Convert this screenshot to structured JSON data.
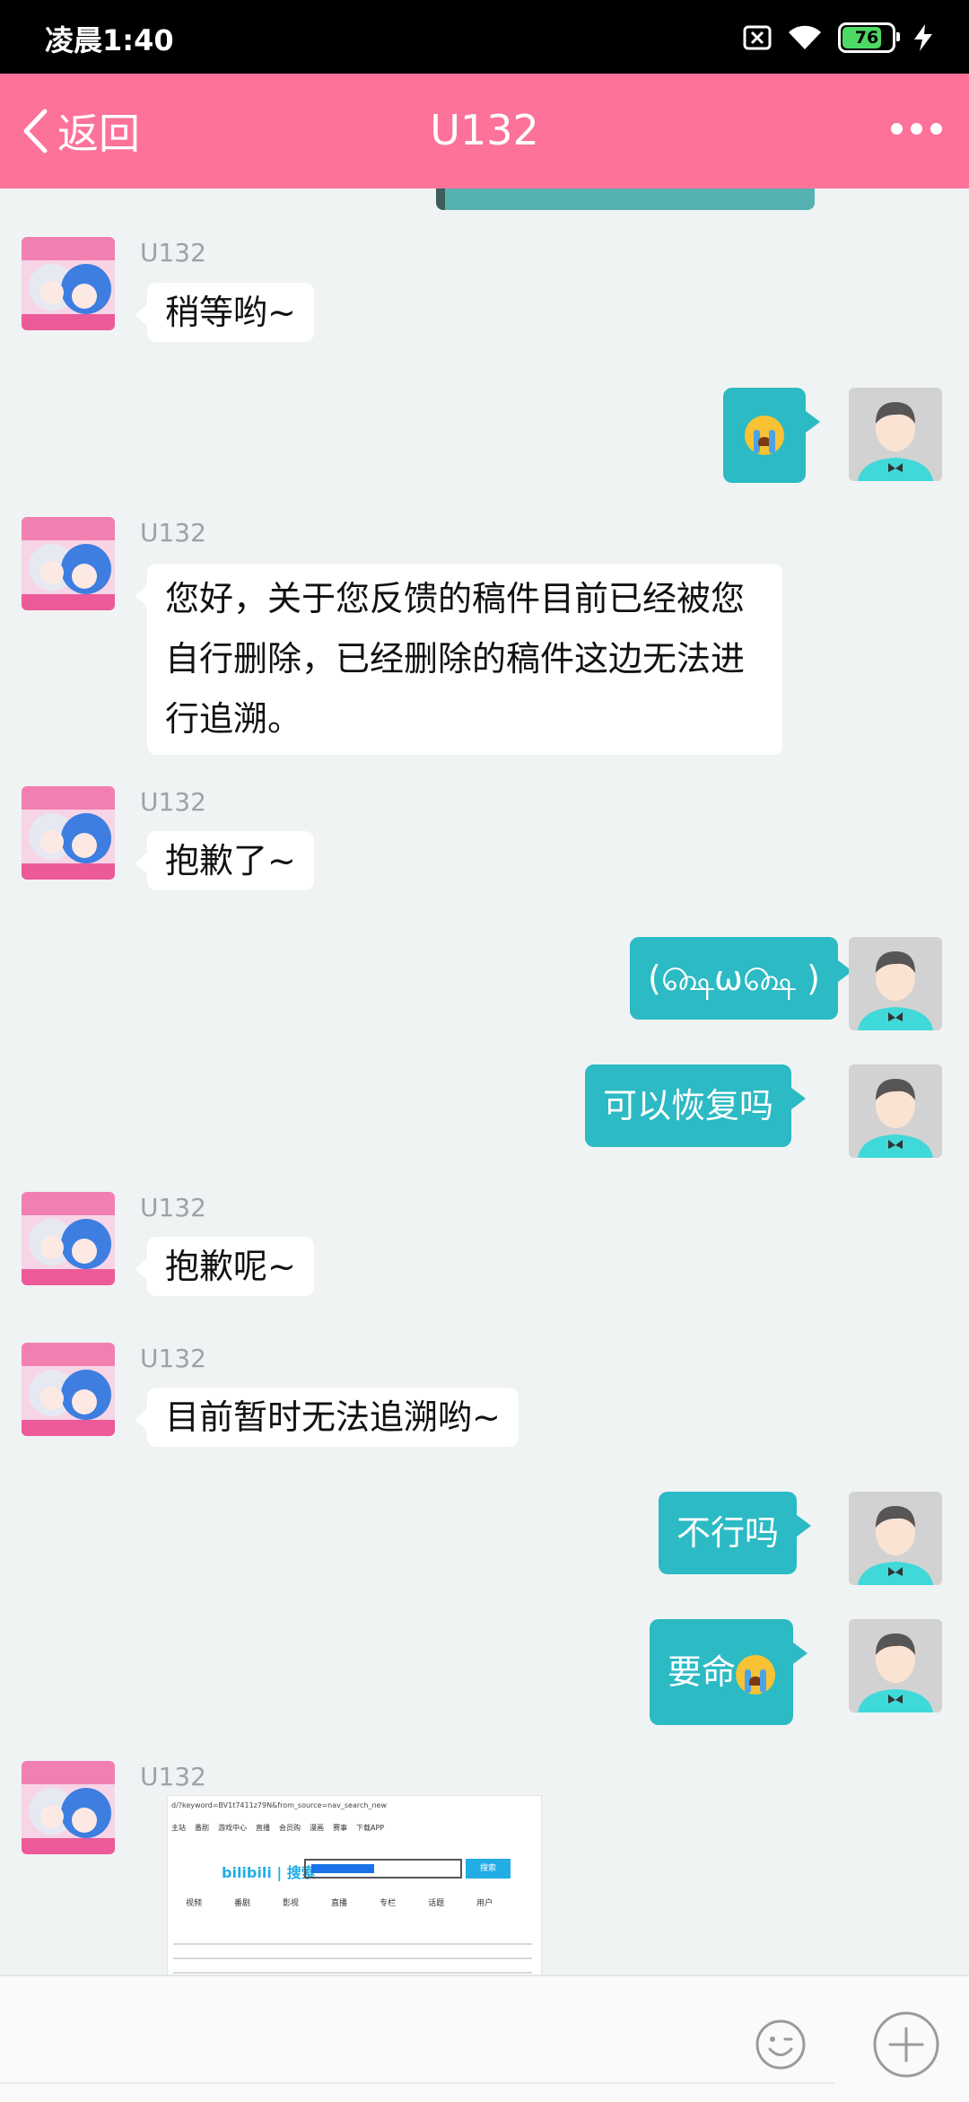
{
  "status_bar": {
    "time": "凌晨1:40",
    "battery": "76"
  },
  "header": {
    "back_label": "返回",
    "title": "U132"
  },
  "messages": [
    {
      "sender": "U132",
      "text": "稍等哟~"
    },
    {
      "sender": "me",
      "text": "",
      "emoji": "crying-face"
    },
    {
      "sender": "U132",
      "text": "您好，关于您反馈的稿件目前已经被您自行删除，已经删除的稿件这边无法进行追溯。"
    },
    {
      "sender": "U132",
      "text": "抱歉了~"
    },
    {
      "sender": "me",
      "text": "(௸ω௸ )"
    },
    {
      "sender": "me",
      "text": "可以恢复吗"
    },
    {
      "sender": "U132",
      "text": "抱歉呢~"
    },
    {
      "sender": "U132",
      "text": "目前暂时无法追溯哟~"
    },
    {
      "sender": "me",
      "text": "不行吗"
    },
    {
      "sender": "me",
      "text": "要命",
      "emoji": "crying-face"
    },
    {
      "sender": "U132",
      "text": "",
      "image": "search-page-screenshot"
    }
  ],
  "screenshot_image": {
    "url": "d/?keyword=BV1t7411z79N&from_source=nav_search_new",
    "nav": [
      "主站",
      "番剧",
      "游戏中心",
      "直播",
      "会员购",
      "漫画",
      "赛事",
      "下载APP"
    ],
    "logo": "bilibili | 搜索",
    "search_button": "搜索",
    "tabs": [
      "视频",
      "番剧",
      "影视",
      "直播",
      "专栏",
      "话题",
      "用户"
    ]
  },
  "input_bar": {
    "emoji_icon": "smiley-icon",
    "plus_icon": "plus-circle-icon"
  },
  "colors": {
    "header": "#fc7299",
    "outgoing_bubble": "#2cbac4",
    "background": "#eff3f3"
  }
}
